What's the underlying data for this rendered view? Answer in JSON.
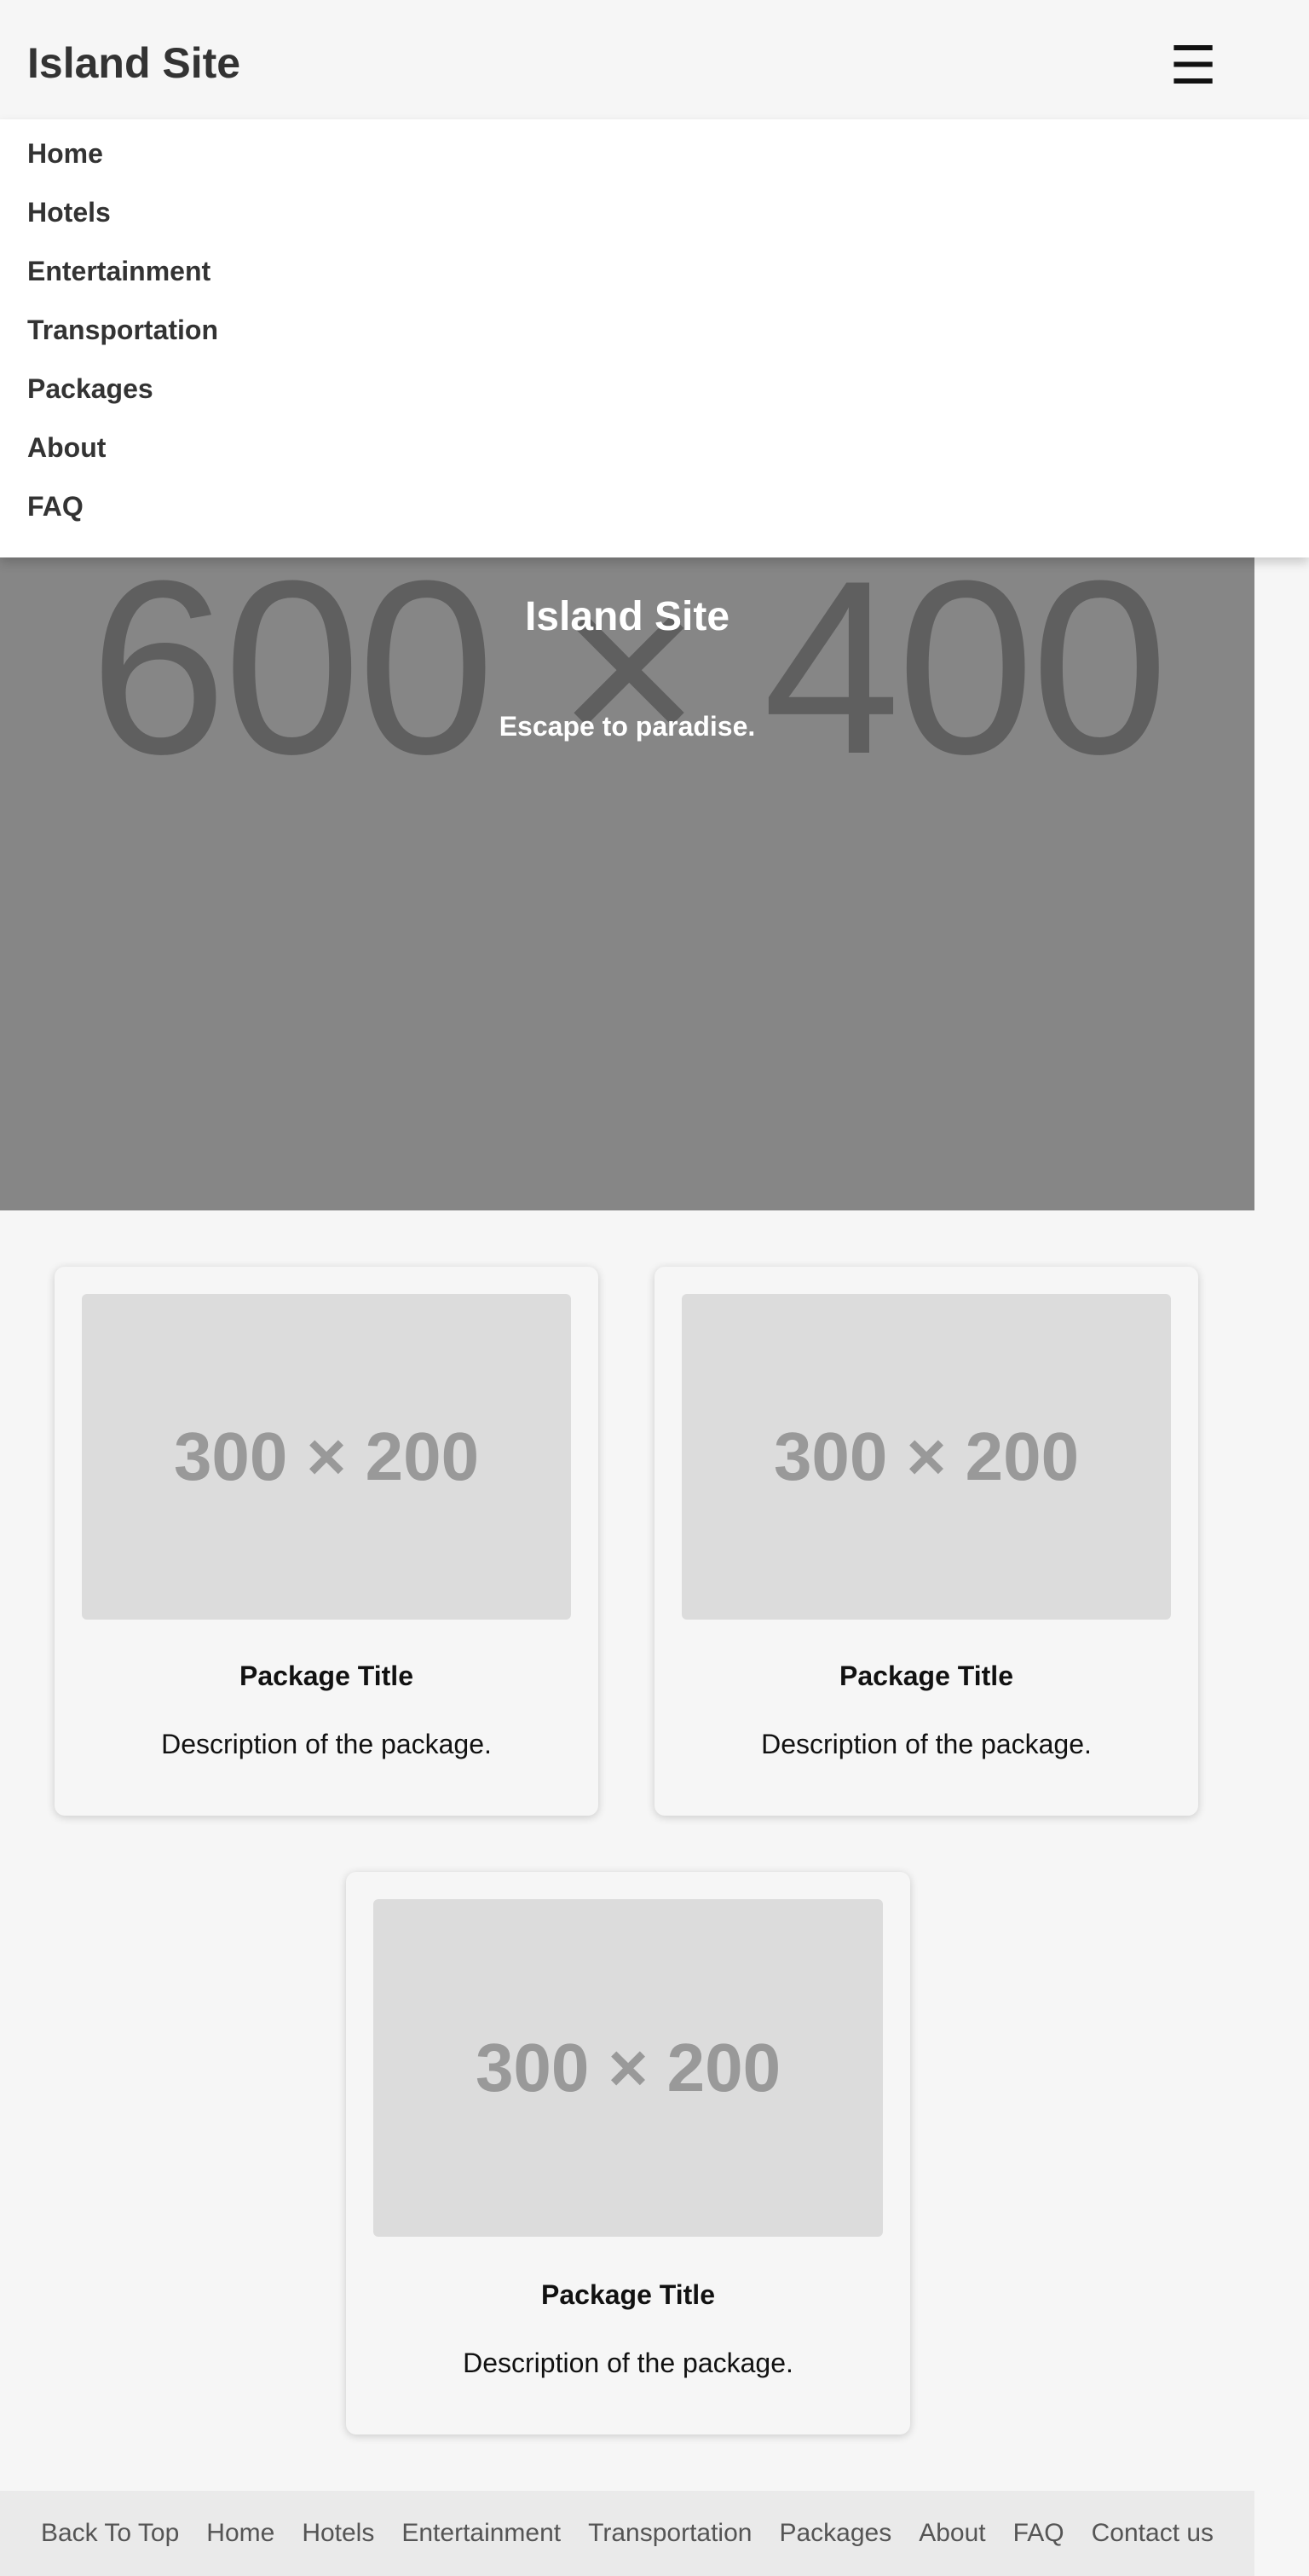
{
  "header": {
    "site_title": "Island Site",
    "menu_icon": "☰"
  },
  "nav": {
    "items": [
      {
        "label": "Home"
      },
      {
        "label": "Hotels"
      },
      {
        "label": "Entertainment"
      },
      {
        "label": "Transportation"
      },
      {
        "label": "Packages"
      },
      {
        "label": "About"
      },
      {
        "label": "FAQ"
      }
    ]
  },
  "hero": {
    "placeholder_text": "600 × 400",
    "title": "Island Site",
    "tagline": "Escape to paradise."
  },
  "packages": [
    {
      "image_text": "300 × 200",
      "title": "Package Title",
      "description": "Description of the package."
    },
    {
      "image_text": "300 × 200",
      "title": "Package Title",
      "description": "Description of the package."
    },
    {
      "image_text": "300 × 200",
      "title": "Package Title",
      "description": "Description of the package."
    }
  ],
  "footer": {
    "links": [
      {
        "label": "Back To Top"
      },
      {
        "label": "Home"
      },
      {
        "label": "Hotels"
      },
      {
        "label": "Entertainment"
      },
      {
        "label": "Transportation"
      },
      {
        "label": "Packages"
      },
      {
        "label": "About"
      },
      {
        "label": "FAQ"
      },
      {
        "label": "Contact us"
      }
    ]
  },
  "colors": {
    "page_background": "#f6f6f6",
    "hero_background": "#868686",
    "image_placeholder": "#dcdcdc",
    "footer_background": "#eaeaea"
  }
}
